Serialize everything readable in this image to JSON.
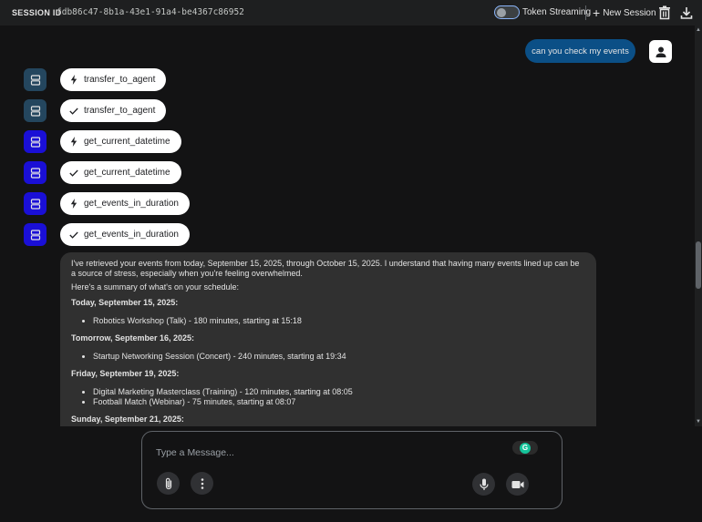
{
  "header": {
    "session_label": "SESSION ID",
    "session_id": "fdb86c47-8b1a-43e1-91a4-be4367c86952",
    "token_streaming_label": "Token Streaming",
    "new_session_label": "New Session"
  },
  "chat": {
    "user_message": "can you check my events",
    "tool_calls": [
      {
        "status": "call",
        "name": "transfer_to_agent",
        "icon": "bolt-icon"
      },
      {
        "status": "done",
        "name": "transfer_to_agent",
        "icon": "check-icon"
      },
      {
        "status": "call",
        "name": "get_current_datetime",
        "icon": "bolt-icon"
      },
      {
        "status": "done",
        "name": "get_current_datetime",
        "icon": "check-icon"
      },
      {
        "status": "call",
        "name": "get_events_in_duration",
        "icon": "bolt-icon"
      },
      {
        "status": "done",
        "name": "get_events_in_duration",
        "icon": "check-icon"
      }
    ],
    "response": {
      "intro": "I've retrieved your events from today, September 15, 2025, through October 15, 2025. I understand that having many events lined up can be a source of stress, especially when you're feeling overwhelmed.",
      "summary_lead": "Here's a summary of what's on your schedule:",
      "days": [
        {
          "date": "Today, September 15, 2025:",
          "events": [
            "Robotics Workshop (Talk) - 180 minutes, starting at 15:18"
          ]
        },
        {
          "date": "Tomorrow, September 16, 2025:",
          "events": [
            "Startup Networking Session (Concert) - 240 minutes, starting at 19:34"
          ]
        },
        {
          "date": "Friday, September 19, 2025:",
          "events": [
            "Digital Marketing Masterclass (Training) - 120 minutes, starting at 08:05",
            "Football Match (Webinar) - 75 minutes, starting at 08:07"
          ]
        },
        {
          "date": "Sunday, September 21, 2025:",
          "events": []
        }
      ]
    }
  },
  "composer": {
    "placeholder": "Type a Message..."
  },
  "colors": {
    "user_bubble": "#0b4f86",
    "agent_dark": "#24465e",
    "agent_blue": "#1a0fd6",
    "background": "#131314",
    "response_bg": "#303030"
  }
}
